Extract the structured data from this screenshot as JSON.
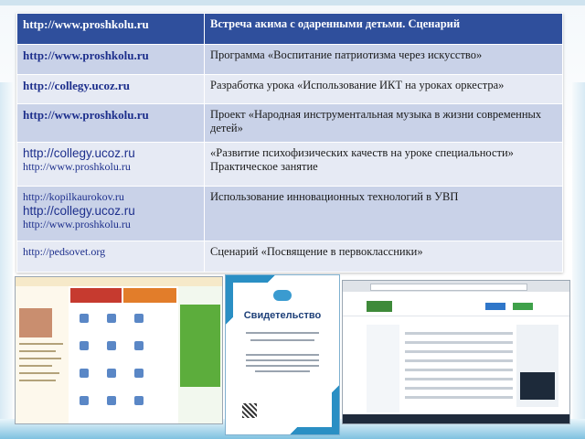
{
  "table": {
    "rows": [
      {
        "links": [
          "http://www.proshkolu.ru"
        ],
        "title": "Встреча акима с одаренными детьми. Сценарий"
      },
      {
        "links": [
          "http://www.proshkolu.ru"
        ],
        "title": "Программа «Воспитание патриотизма через искусство»"
      },
      {
        "links": [
          "http://collegy.ucoz.ru"
        ],
        "title": "Разработка урока «Использование ИКТ на уроках оркестра»"
      },
      {
        "links": [
          "http://www.proshkolu.ru"
        ],
        "title": "Проект «Народная инструментальная музыка в жизни современных детей»"
      },
      {
        "links": [
          "http://collegy.ucoz.ru",
          "http://www.proshkolu.ru"
        ],
        "title": "«Развитие психофизических качеств на уроке специальности» Практическое занятие"
      },
      {
        "links": [
          "http://kopilkaurokov.ru",
          "http://collegy.ucoz.ru",
          "http://www.proshkolu.ru"
        ],
        "title": "Использование инновационных технологий в УВП"
      },
      {
        "links": [
          "http://pedsovet.org"
        ],
        "title": "Сценарий «Посвящение в первоклассники»"
      }
    ]
  },
  "certificate": {
    "title": "Свидетельство"
  },
  "colors": {
    "header": "#2f4f9c",
    "row_dark": "#c9d2e8",
    "row_light": "#e6eaf4",
    "link": "#1d2f8c"
  }
}
